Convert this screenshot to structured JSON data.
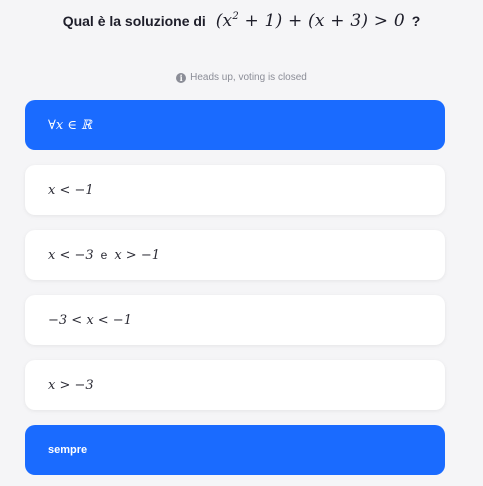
{
  "question": {
    "prefix": "Qual è la soluzione di",
    "expr_open": "(x",
    "expr_exp": "2",
    "expr_rest": " + 1) + (x + 3) > 0",
    "suffix": "?"
  },
  "notice": {
    "icon": "info-icon",
    "text": "Heads up, voting is closed"
  },
  "options": [
    {
      "text": "∀x ∈ ℝ",
      "selected": true
    },
    {
      "text": "x < −1",
      "selected": false
    },
    {
      "text_a": "x < −3",
      "conjunction": "e",
      "text_b": "x > −1",
      "selected": false
    },
    {
      "text": "−3 < x < −1",
      "selected": false
    },
    {
      "text": "x > −3",
      "selected": false
    },
    {
      "text": "sempre",
      "selected": true
    }
  ],
  "colors": {
    "selected_background": "#1a6bff",
    "page_background": "#f5f5f7",
    "option_background": "#ffffff"
  }
}
